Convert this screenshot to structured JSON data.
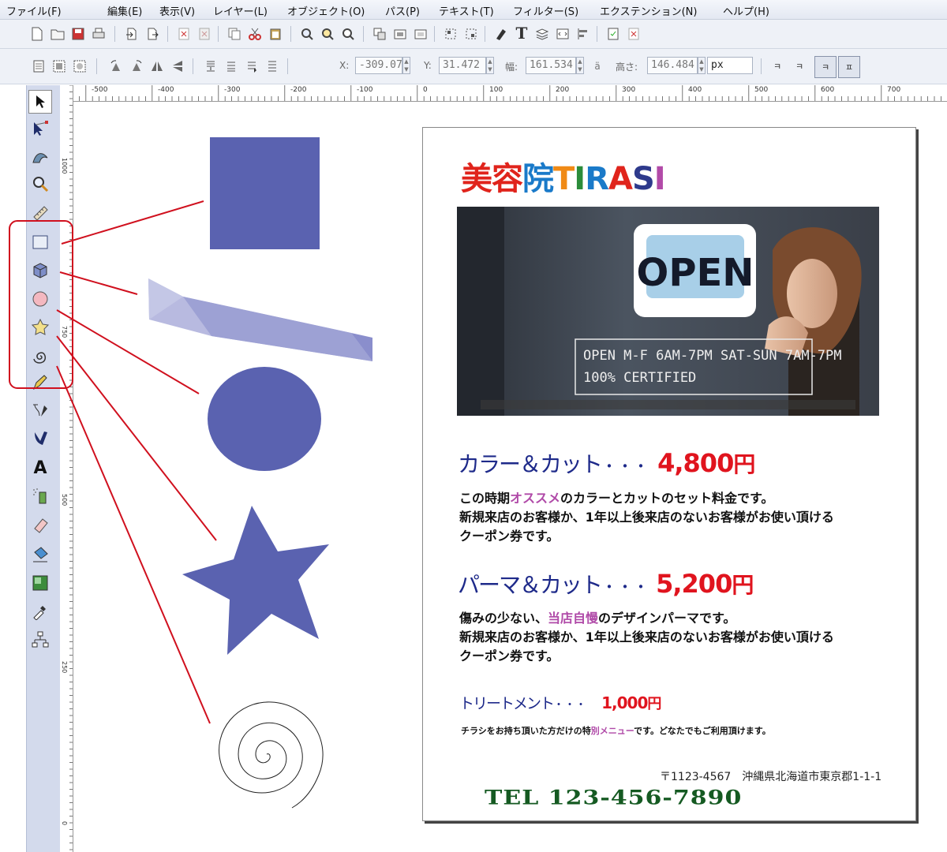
{
  "menu": [
    "ファイル(F)",
    "編集(E)",
    "表示(V)",
    "レイヤー(L)",
    "オブジェクト(O)",
    "パス(P)",
    "テキスト(T)",
    "フィルター(S)",
    "エクステンション(N)",
    "ヘルプ(H)"
  ],
  "toolbar_controls": {
    "x_label": "X:",
    "x_value": "-309.07",
    "y_label": "Y:",
    "y_value": "31.472",
    "w_label": "幅:",
    "w_value": "161.534",
    "h_label": "高さ:",
    "h_value": "146.484",
    "unit": "px"
  },
  "ruler_labels": [
    "-500",
    "-400",
    "-300",
    "-200",
    "-100",
    "0",
    "100",
    "200",
    "300",
    "400",
    "500",
    "600",
    "700"
  ],
  "vruler_labels": [
    "1000",
    "750",
    "500",
    "250",
    "0"
  ],
  "flyer": {
    "title_chars": [
      {
        "c": "美",
        "color": "#e0241c"
      },
      {
        "c": "容",
        "color": "#e0241c"
      },
      {
        "c": "院",
        "color": "#1a7ac9"
      },
      {
        "c": "T",
        "color": "#f08a16"
      },
      {
        "c": "I",
        "color": "#2b8c3a"
      },
      {
        "c": "R",
        "color": "#1a7ac9"
      },
      {
        "c": "A",
        "color": "#e0241c"
      },
      {
        "c": "S",
        "color": "#2e3a8c"
      },
      {
        "c": "I",
        "color": "#b24aa8"
      }
    ],
    "photo": {
      "sign_text": "OPEN",
      "hours": "OPEN M-F 6AM-7PM SAT-SUN 7AM-7PM",
      "certified": "100% CERTIFIED"
    },
    "item1": {
      "name": "カラー＆カット",
      "dots": "・・・",
      "price": "4,800",
      "yen": "円",
      "line1_a": "この時期",
      "line1_b": "オススメ",
      "line1_c": "のカラーとカットのセット料金です。",
      "line2": "新規来店のお客様か、1年以上後来店のないお客様がお使い頂ける",
      "line3": "クーポン券です。"
    },
    "item2": {
      "name": "パーマ＆カット",
      "dots": "・・・",
      "price": "5,200",
      "yen": "円",
      "line1_a": "傷みの少ない、",
      "line1_b": "当店自慢",
      "line1_c": "のデザインパーマです。",
      "line2": "新規来店のお客様か、1年以上後来店のないお客様がお使い頂ける",
      "line3": "クーポン券です。"
    },
    "item3": {
      "name": "トリートメント",
      "dots": "・・・",
      "price": "1,000",
      "yen": "円",
      "note_a": "チラシをお持ち頂いた方だけの特",
      "note_b": "別メニュー",
      "note_c": "です。どなたでもご利用頂けます。"
    },
    "address": "〒1123-4567　沖縄県北海道市東京郡1-1-1",
    "tel": "TEL 123-456-7890"
  },
  "colors": {
    "shape_fill": "#5a62b0",
    "annotation": "#d0101e",
    "navy": "#1e2a8a",
    "price_red": "#e0141e",
    "pink": "#b04aa8",
    "tel_green": "#155a22"
  }
}
